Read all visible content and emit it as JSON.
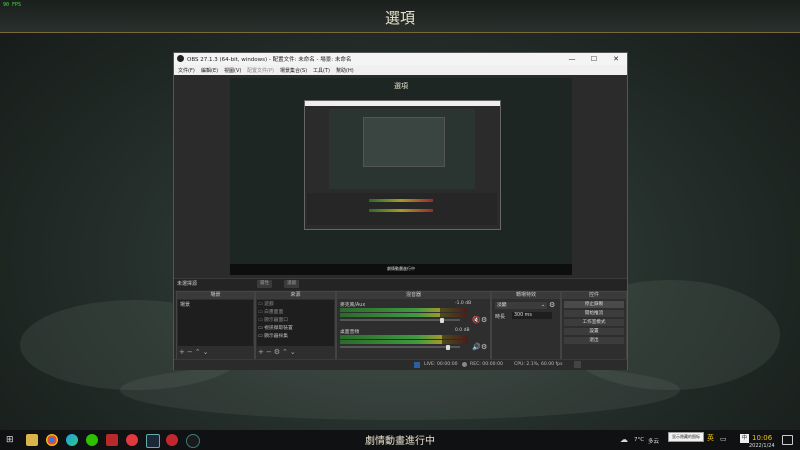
{
  "overlay": {
    "fps": "90 FPS"
  },
  "game": {
    "title": "選項",
    "subtitle": "劇情動畫進行中"
  },
  "obs": {
    "window_title": "OBS 27.1.3 (64-bit, windows) - 配置文件: 未命名 - 場景: 未命名",
    "window_buttons": {
      "minimize": "—",
      "maximize": "☐",
      "close": "✕"
    },
    "menu": [
      "文件(F)",
      "編輯(E)",
      "視圖(V)",
      "配置文件(P)",
      "場景集合(S)",
      "工具(T)",
      "幫助(H)"
    ],
    "preview": {
      "title": "選項",
      "caption": "劇情動畫進行中"
    },
    "no_source_selected": "未選擇源",
    "scene_buttons": {
      "properties": "屬性",
      "filters": "濾鏡"
    },
    "docks": {
      "scenes": {
        "title": "場景",
        "items": [
          "場景"
        ]
      },
      "sources": {
        "title": "來源",
        "items": [
          "遊戲",
          "白畫面面",
          "顯示器面口",
          "視訊擷取裝置",
          "顯示器採集"
        ]
      },
      "mixer": {
        "title": "混音器",
        "channels": [
          {
            "name": "麥克風/Aux",
            "db": "-1.0 dB",
            "level": 0.78,
            "volume": 0.85,
            "muted": true
          },
          {
            "name": "桌面音頻",
            "db": "0.0 dB",
            "level": 0.8,
            "volume": 0.9,
            "muted": false
          }
        ]
      },
      "transitions": {
        "title": "轉場特效",
        "selected": "淡變",
        "duration_label": "時長",
        "duration_value": "300 ms"
      },
      "controls": {
        "title": "控件",
        "buttons": [
          "停止錄製",
          "開始推流",
          "工作室模式",
          "設置",
          "退出"
        ]
      }
    },
    "status": {
      "live": "LIVE: 00:00:00",
      "rec": "REC: 00:00:00",
      "cpu": "CPU: 2.1%, 60.00 fps"
    }
  },
  "taskbar": {
    "temp": "7°C",
    "weather": "多云",
    "tooltip": "显示隐藏的图标",
    "ime": "英",
    "time": "10:06",
    "date": "2022/1/24"
  }
}
